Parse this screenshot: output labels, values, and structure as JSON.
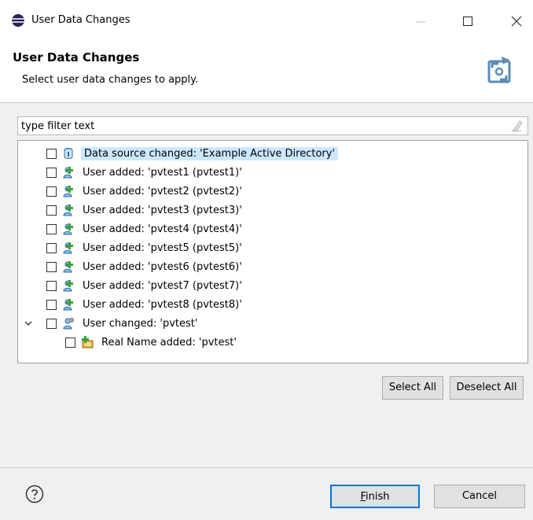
{
  "window": {
    "title": "User Data Changes",
    "icons": {
      "app": "eclipse-sphere-icon",
      "minimize": "minimize-icon",
      "maximize": "maximize-icon",
      "close": "close-icon"
    }
  },
  "header": {
    "title": "User Data Changes",
    "description": "Select user data changes to apply.",
    "graphic_icon": "sync-wizard-icon"
  },
  "filter": {
    "placeholder": "type filter text",
    "value": "",
    "clear_icon": "eraser-icon"
  },
  "tree": {
    "items": [
      {
        "label": "Data source changed: 'Example Active Directory'",
        "icon": "data-source-icon",
        "checked": false,
        "selected": true
      },
      {
        "label": "User added: 'pvtest1 (pvtest1)'",
        "icon": "user-add-icon",
        "checked": false
      },
      {
        "label": "User added: 'pvtest2 (pvtest2)'",
        "icon": "user-add-icon",
        "checked": false
      },
      {
        "label": "User added: 'pvtest3 (pvtest3)'",
        "icon": "user-add-icon",
        "checked": false
      },
      {
        "label": "User added: 'pvtest4 (pvtest4)'",
        "icon": "user-add-icon",
        "checked": false
      },
      {
        "label": "User added: 'pvtest5 (pvtest5)'",
        "icon": "user-add-icon",
        "checked": false
      },
      {
        "label": "User added: 'pvtest6 (pvtest6)'",
        "icon": "user-add-icon",
        "checked": false
      },
      {
        "label": "User added: 'pvtest7 (pvtest7)'",
        "icon": "user-add-icon",
        "checked": false
      },
      {
        "label": "User added: 'pvtest8 (pvtest8)'",
        "icon": "user-add-icon",
        "checked": false
      },
      {
        "label": "User changed: 'pvtest'",
        "icon": "user-changed-icon",
        "checked": false,
        "expanded": true,
        "expander_icon": "chevron-down-icon"
      },
      {
        "label": "Real Name added: 'pvtest'",
        "icon": "attribute-add-icon",
        "checked": false,
        "child": true
      }
    ]
  },
  "buttons": {
    "select_all": "Select All",
    "deselect_all": "Deselect All",
    "finish_mnemonic": "F",
    "finish_rest": "inish",
    "cancel": "Cancel"
  },
  "help_icon": "help-icon",
  "colors": {
    "selection": "#cce8ff",
    "default_button_border": "#0078d7"
  }
}
